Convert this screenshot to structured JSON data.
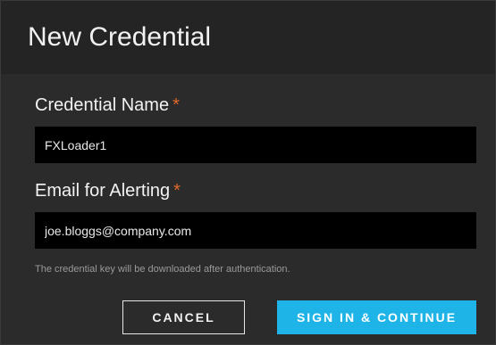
{
  "dialog": {
    "title": "New Credential"
  },
  "fields": {
    "credential_name": {
      "label": "Credential Name",
      "required_mark": "*",
      "value": "FXLoader1"
    },
    "alert_email": {
      "label": "Email for Alerting",
      "required_mark": "*",
      "value": "joe.bloggs@company.com"
    }
  },
  "hint": "The credential key will be downloaded after authentication.",
  "actions": {
    "cancel_label": "CANCEL",
    "submit_label": "SIGN IN & CONTINUE"
  },
  "colors": {
    "dialog_background": "#2b2b2b",
    "header_background": "#242424",
    "input_background": "#000000",
    "required_mark": "#e06a2c",
    "primary_button": "#1fb4e8"
  }
}
